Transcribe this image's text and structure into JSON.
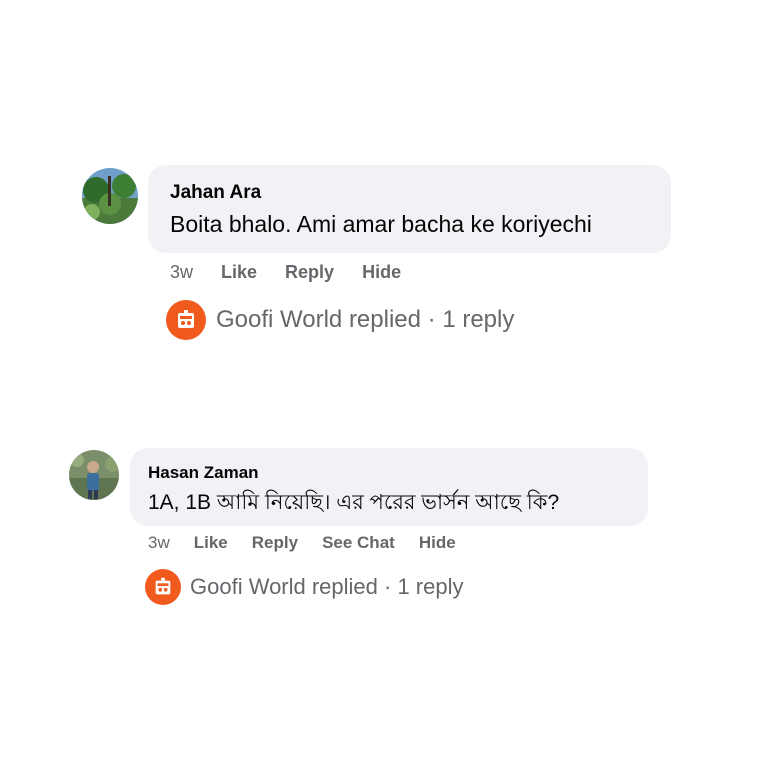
{
  "comments": [
    {
      "author": "Jahan Ara",
      "text": "Boita bhalo. Ami amar bacha ke koriyechi",
      "time": "3w",
      "actions": [
        "Like",
        "Reply",
        "Hide"
      ],
      "replied_label": "Goofi World replied · 1 reply",
      "avatar_icon": "profile-photo-trees"
    },
    {
      "author": "Hasan Zaman",
      "text": "1A, 1B আমি নিয়েছি। এর পরের ভার্সন আছে কি?",
      "time": "3w",
      "actions": [
        "Like",
        "Reply",
        "See Chat",
        "Hide"
      ],
      "replied_label": "Goofi World replied · 1 reply",
      "avatar_icon": "profile-photo-person"
    }
  ],
  "colors": {
    "bubble": "#f0f2f5",
    "secondary_text": "#65676b",
    "page_icon": "#f05a1c"
  }
}
